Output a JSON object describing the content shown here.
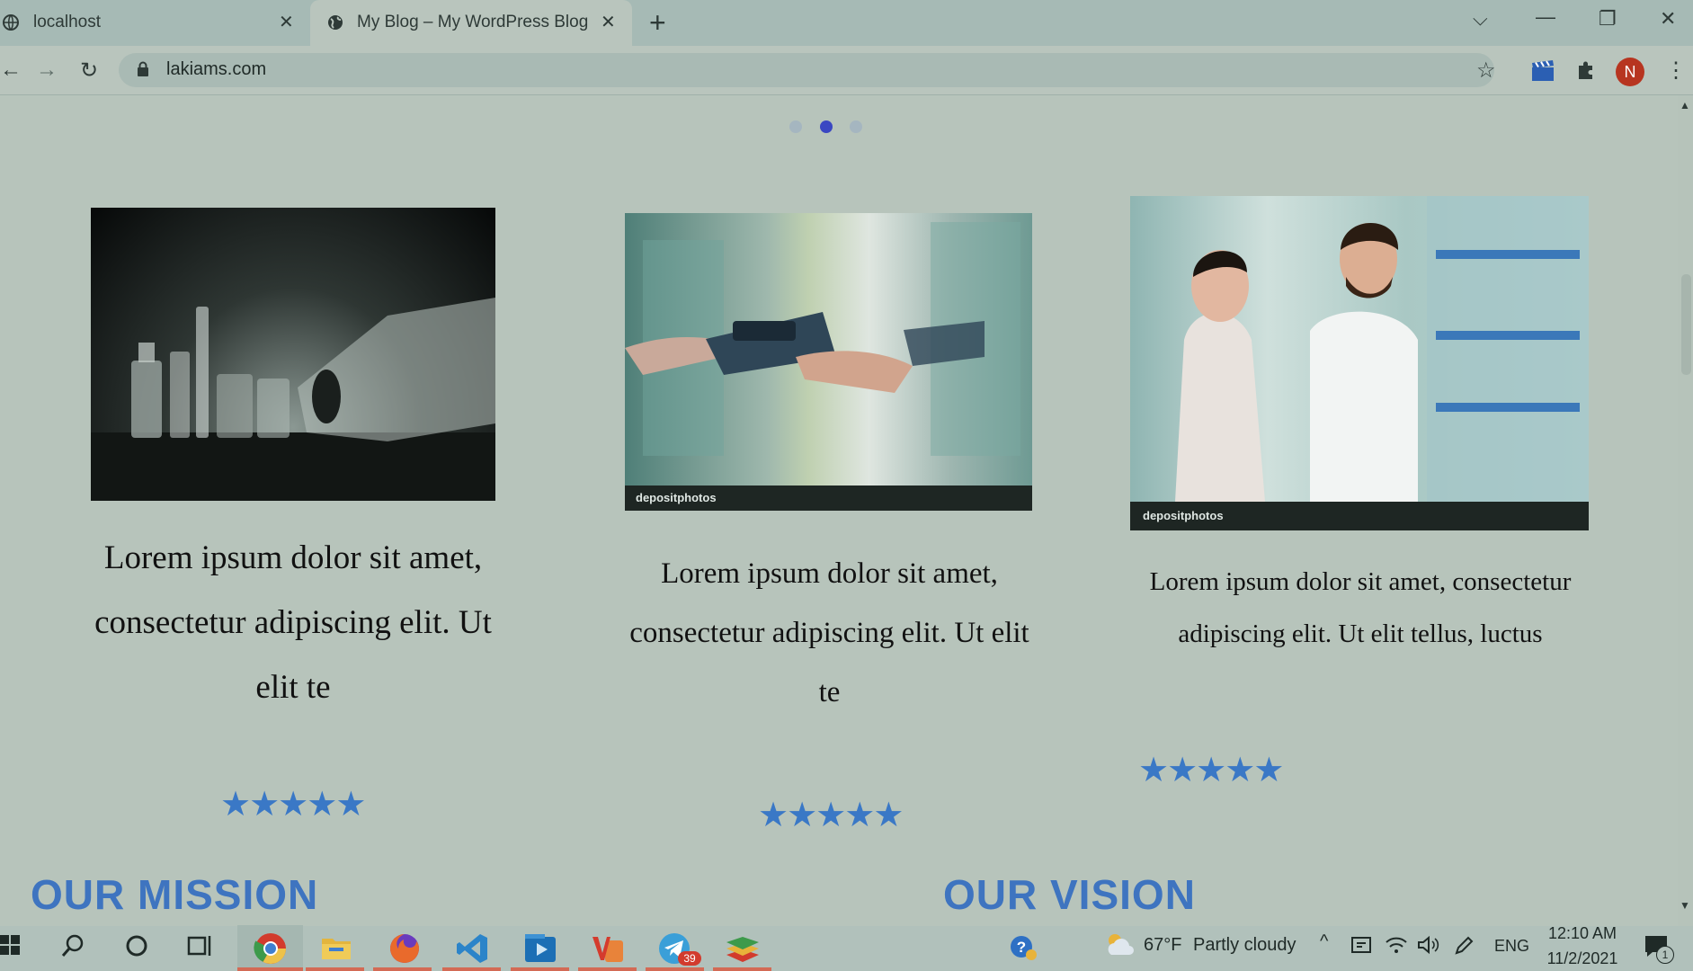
{
  "browser": {
    "tabs": [
      {
        "title": "localhost"
      },
      {
        "title": "My Blog – My WordPress Blog"
      }
    ],
    "url": "lakiams.com",
    "profile_initial": "N"
  },
  "carousel": {
    "dot_count": 3,
    "active_index": 1
  },
  "cards": [
    {
      "text": "Lorem ipsum dolor sit amet, consectetur adipiscing elit. Ut elit te",
      "rating": 5
    },
    {
      "text": "Lorem ipsum dolor sit amet, consectetur adipiscing elit. Ut elit te",
      "rating": 5,
      "watermark": "depositphotos"
    },
    {
      "text": "Lorem ipsum dolor sit amet, consectetur adipiscing elit. Ut elit tellus, luctus",
      "rating": 5,
      "watermark": "depositphotos"
    }
  ],
  "sections": {
    "mission": "OUR MISSION",
    "vision": "OUR VISION"
  },
  "taskbar": {
    "weather_temp": "67°F",
    "weather_desc": "Partly cloudy",
    "language": "ENG",
    "time": "12:10 AM",
    "date": "11/2/2021",
    "telegram_badge": "39",
    "notification_count": "1"
  }
}
